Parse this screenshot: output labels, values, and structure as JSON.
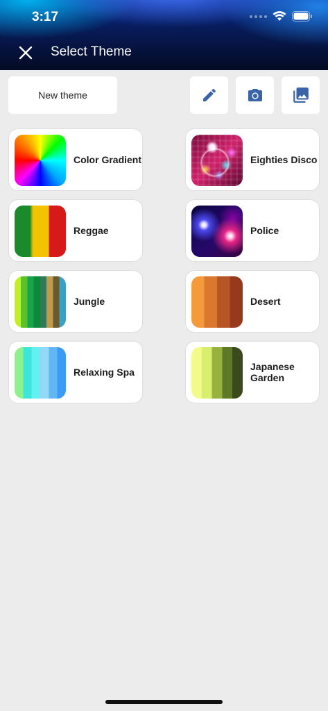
{
  "status_bar": {
    "time": "3:17",
    "icons": [
      "signal-dots-icon",
      "wifi-icon",
      "battery-icon"
    ]
  },
  "header": {
    "title": "Select Theme",
    "close_icon": "close-icon"
  },
  "toolbar": {
    "new_theme_label": "New theme",
    "buttons": [
      "edit-icon",
      "camera-icon",
      "gallery-icon"
    ],
    "icon_color": "#3a63a8"
  },
  "themes": [
    {
      "name": "Color Gradient"
    },
    {
      "name": "Eighties Disco"
    },
    {
      "name": "Reggae"
    },
    {
      "name": "Police"
    },
    {
      "name": "Jungle"
    },
    {
      "name": "Desert"
    },
    {
      "name": "Relaxing Spa"
    },
    {
      "name": "Japanese Garden"
    }
  ],
  "colors": {
    "page_background": "#ececec",
    "card_background": "#ffffff",
    "header_dark": "#030a22",
    "header_accent": "#0a2a8a"
  }
}
